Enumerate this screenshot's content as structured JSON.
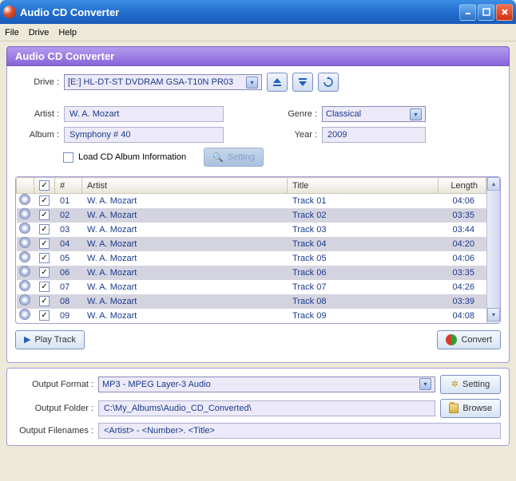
{
  "window": {
    "title": "Audio CD Converter"
  },
  "menu": {
    "file": "File",
    "drive": "Drive",
    "help": "Help"
  },
  "header": "Audio CD Converter",
  "drive": {
    "label": "Drive :",
    "value": "[E:] HL-DT-ST DVDRAM GSA-T10N  PR03"
  },
  "info": {
    "artist_label": "Artist :",
    "artist": "W. A. Mozart",
    "album_label": "Album :",
    "album": "Symphony # 40",
    "genre_label": "Genre :",
    "genre": "Classical",
    "year_label": "Year :",
    "year": "2009",
    "load_label": "Load CD Album Information",
    "setting_btn": "Setting"
  },
  "grid": {
    "headers": {
      "num": "#",
      "artist": "Artist",
      "title": "Title",
      "length": "Length"
    },
    "rows": [
      {
        "n": "01",
        "artist": "W. A. Mozart",
        "title": "Track 01",
        "len": "04:06"
      },
      {
        "n": "02",
        "artist": "W. A. Mozart",
        "title": "Track 02",
        "len": "03:35"
      },
      {
        "n": "03",
        "artist": "W. A. Mozart",
        "title": "Track 03",
        "len": "03:44"
      },
      {
        "n": "04",
        "artist": "W. A. Mozart",
        "title": "Track 04",
        "len": "04:20"
      },
      {
        "n": "05",
        "artist": "W. A. Mozart",
        "title": "Track 05",
        "len": "04:06"
      },
      {
        "n": "06",
        "artist": "W. A. Mozart",
        "title": "Track 06",
        "len": "03:35"
      },
      {
        "n": "07",
        "artist": "W. A. Mozart",
        "title": "Track 07",
        "len": "04:26"
      },
      {
        "n": "08",
        "artist": "W. A. Mozart",
        "title": "Track 08",
        "len": "03:39"
      },
      {
        "n": "09",
        "artist": "W. A. Mozart",
        "title": "Track 09",
        "len": "04:08"
      }
    ]
  },
  "buttons": {
    "play": "Play Track",
    "convert": "Convert",
    "setting": "Setting",
    "browse": "Browse"
  },
  "output": {
    "format_label": "Output Format :",
    "format": "MP3 - MPEG Layer-3 Audio",
    "folder_label": "Output Folder :",
    "folder": "C:\\My_Albums\\Audio_CD_Converted\\",
    "filenames_label": "Output Filenames :",
    "filenames": "<Artist> - <Number>. <Title>"
  }
}
